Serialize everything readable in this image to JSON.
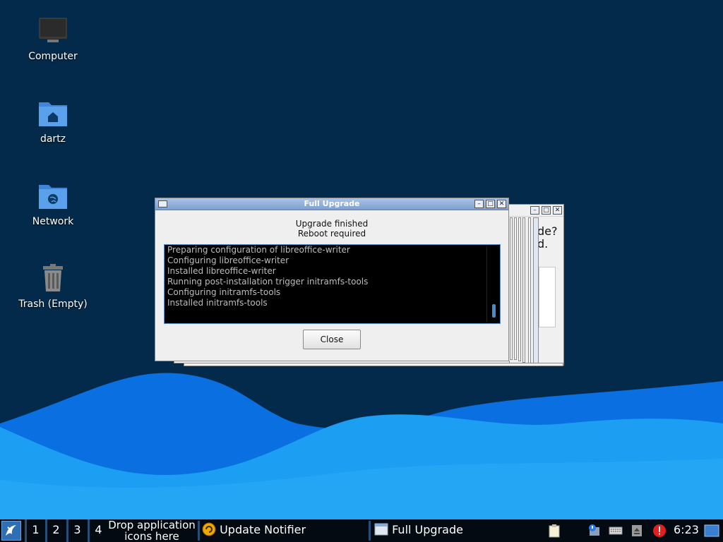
{
  "desktop": {
    "icons": [
      {
        "label": "Computer"
      },
      {
        "label": "dartz"
      },
      {
        "label": "Network"
      },
      {
        "label": "Trash (Empty)"
      }
    ]
  },
  "background_window": {
    "line1": "de?",
    "line2": "d."
  },
  "upgrade_window": {
    "title": "Full Upgrade",
    "status_line1": "Upgrade finished",
    "status_line2": "Reboot required",
    "log_lines": [
      "Preparing configuration of libreoffice-writer",
      "Configuring libreoffice-writer",
      "Installed libreoffice-writer",
      "Running post-installation trigger initramfs-tools",
      "Configuring initramfs-tools",
      "Installed initramfs-tools"
    ],
    "close_label": "Close"
  },
  "taskbar": {
    "workspaces": [
      "1",
      "2",
      "3",
      "4"
    ],
    "drop_line1": "Drop application",
    "drop_line2": "icons here",
    "tasks": [
      {
        "label": "Update Notifier",
        "icon": "update-notifier-icon"
      },
      {
        "label": "Full Upgrade",
        "icon": "window-icon"
      }
    ],
    "clock": "6:23"
  },
  "colors": {
    "desktop_bg": "#042a4b",
    "wave_light": "#1e9ff5",
    "wave_dark": "#0a6fe0",
    "titlebar": "#8aaad8",
    "error_tray": "#e02020"
  }
}
